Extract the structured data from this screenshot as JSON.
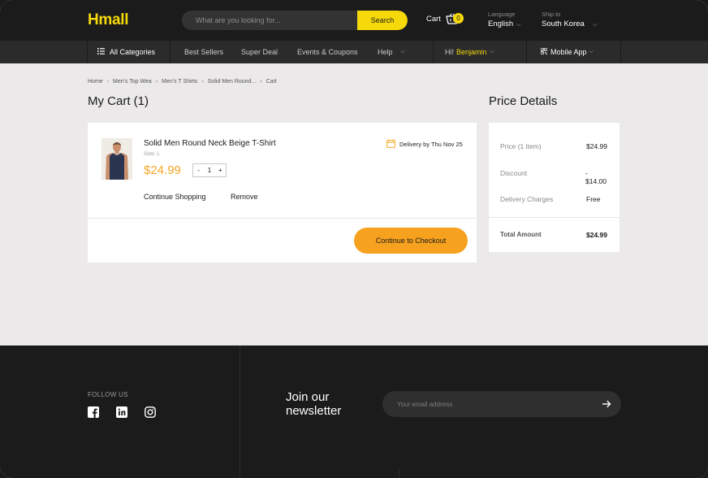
{
  "header": {
    "logo": "Hmall",
    "search": {
      "placeholder": "What are you looking for...",
      "button_label": "Search"
    },
    "cart": {
      "label": "Cart",
      "count": "0"
    },
    "language": {
      "label": "Language",
      "value": "English"
    },
    "ship_to": {
      "label": "Ship to",
      "value": "South Korea"
    }
  },
  "nav": {
    "all_categories": "All Categories",
    "items": [
      "Best Sellers",
      "Super Deal",
      "Events & Coupons",
      "Help"
    ],
    "greeting": "Hi!",
    "user_name": "Benjamin",
    "mobile_app": "Mobile App"
  },
  "breadcrumb": [
    "Home",
    "Men's Top Wea",
    "Men's T Shirts",
    "Solid Men Round...",
    "Cart"
  ],
  "cart": {
    "title": "My Cart (1)",
    "item": {
      "name": "Solid Men Round Neck Beige T-Shirt",
      "size": "Size: L",
      "price": "$24.99",
      "qty_minus": "-",
      "qty": "1",
      "qty_plus": "+",
      "delivery": "Delivery by Thu Nov 25"
    },
    "continue_shopping": "Continue Shopping",
    "remove": "Remove",
    "checkout": "Continue to Checkout"
  },
  "price_details": {
    "title": "Price Details",
    "rows": [
      {
        "label": "Price (1 item)",
        "value": "$24.99"
      },
      {
        "label": "Discount",
        "value": "- $14.00"
      },
      {
        "label": "Delivery Charges",
        "value": "Free"
      }
    ],
    "total_label": "Total Amount",
    "total_value": "$24.99"
  },
  "footer": {
    "follow_us": "FOLLOW US",
    "social_icons": [
      "facebook-icon",
      "linkedin-icon",
      "instagram-icon"
    ],
    "newsletter_title": "Join our newsletter",
    "email_placeholder": "Your email address"
  },
  "colors": {
    "brand_yellow": "#f5d90a",
    "accent_orange": "#f7a21f",
    "dark": "#1b1b1b",
    "page_bg": "#ebe9ea"
  }
}
